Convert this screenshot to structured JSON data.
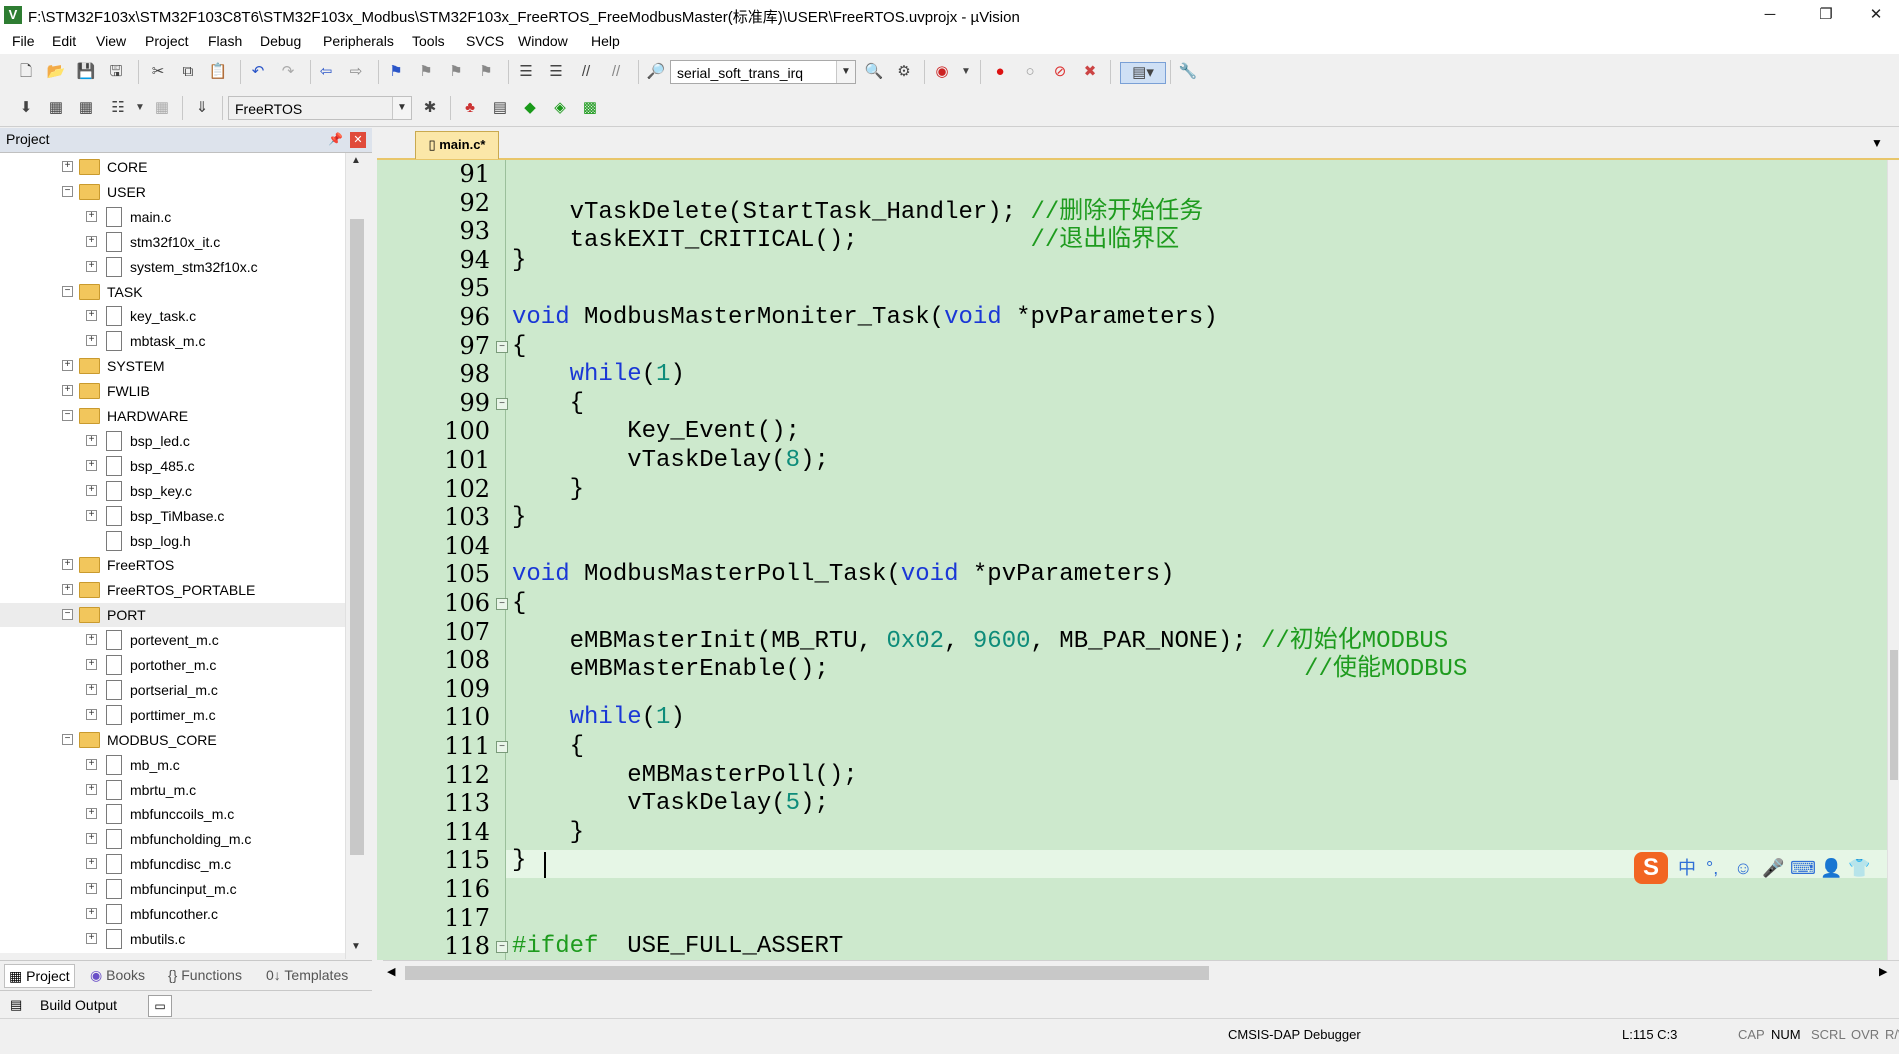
{
  "window": {
    "title": "F:\\STM32F103x\\STM32F103C8T6\\STM32F103x_Modbus\\STM32F103x_FreeRTOS_FreeModbusMaster(标准库)\\USER\\FreeRTOS.uvprojx - µVision",
    "minimize_glyph": "─",
    "restore_glyph": "❐",
    "close_glyph": "✕",
    "app_icon_letter": "V"
  },
  "menu": [
    "File",
    "Edit",
    "View",
    "Project",
    "Flash",
    "Debug",
    "Peripherals",
    "Tools",
    "SVCS",
    "Window",
    "Help"
  ],
  "toolbar": {
    "find_combo_value": "serial_soft_trans_irq",
    "target_combo_value": "FreeRTOS"
  },
  "project_panel": {
    "title": "Project",
    "tree": [
      {
        "label": "CORE",
        "type": "folder",
        "level": 0,
        "expander": "+"
      },
      {
        "label": "USER",
        "type": "folder",
        "level": 0,
        "expander": "−"
      },
      {
        "label": "main.c",
        "type": "file",
        "level": 1,
        "expander": "+"
      },
      {
        "label": "stm32f10x_it.c",
        "type": "file",
        "level": 1,
        "expander": "+"
      },
      {
        "label": "system_stm32f10x.c",
        "type": "file",
        "level": 1,
        "expander": "+"
      },
      {
        "label": "TASK",
        "type": "folder",
        "level": 0,
        "expander": "−"
      },
      {
        "label": "key_task.c",
        "type": "file",
        "level": 1,
        "expander": "+"
      },
      {
        "label": "mbtask_m.c",
        "type": "file",
        "level": 1,
        "expander": "+"
      },
      {
        "label": "SYSTEM",
        "type": "folder",
        "level": 0,
        "expander": "+"
      },
      {
        "label": "FWLIB",
        "type": "folder",
        "level": 0,
        "expander": "+"
      },
      {
        "label": "HARDWARE",
        "type": "folder",
        "level": 0,
        "expander": "−"
      },
      {
        "label": "bsp_led.c",
        "type": "file",
        "level": 1,
        "expander": "+"
      },
      {
        "label": "bsp_485.c",
        "type": "file",
        "level": 1,
        "expander": "+"
      },
      {
        "label": "bsp_key.c",
        "type": "file",
        "level": 1,
        "expander": "+"
      },
      {
        "label": "bsp_TiMbase.c",
        "type": "file",
        "level": 1,
        "expander": "+"
      },
      {
        "label": "bsp_log.h",
        "type": "file",
        "level": 1,
        "expander": ""
      },
      {
        "label": "FreeRTOS",
        "type": "folder",
        "level": 0,
        "expander": "+"
      },
      {
        "label": "FreeRTOS_PORTABLE",
        "type": "folder",
        "level": 0,
        "expander": "+"
      },
      {
        "label": "PORT",
        "type": "folder",
        "level": 0,
        "expander": "−"
      },
      {
        "label": "portevent_m.c",
        "type": "file",
        "level": 1,
        "expander": "+"
      },
      {
        "label": "portother_m.c",
        "type": "file",
        "level": 1,
        "expander": "+"
      },
      {
        "label": "portserial_m.c",
        "type": "file",
        "level": 1,
        "expander": "+"
      },
      {
        "label": "porttimer_m.c",
        "type": "file",
        "level": 1,
        "expander": "+"
      },
      {
        "label": "MODBUS_CORE",
        "type": "folder",
        "level": 0,
        "expander": "−"
      },
      {
        "label": "mb_m.c",
        "type": "file",
        "level": 1,
        "expander": "+"
      },
      {
        "label": "mbrtu_m.c",
        "type": "file",
        "level": 1,
        "expander": "+"
      },
      {
        "label": "mbfunccoils_m.c",
        "type": "file",
        "level": 1,
        "expander": "+"
      },
      {
        "label": "mbfuncholding_m.c",
        "type": "file",
        "level": 1,
        "expander": "+"
      },
      {
        "label": "mbfuncdisc_m.c",
        "type": "file",
        "level": 1,
        "expander": "+"
      },
      {
        "label": "mbfuncinput_m.c",
        "type": "file",
        "level": 1,
        "expander": "+"
      },
      {
        "label": "mbfuncother.c",
        "type": "file",
        "level": 1,
        "expander": "+"
      },
      {
        "label": "mbutils.c",
        "type": "file",
        "level": 1,
        "expander": "+"
      }
    ],
    "tabs": [
      "Project",
      "Books",
      "{} Functions",
      "0↓ Templates"
    ],
    "build_output_label": "Build Output"
  },
  "editor": {
    "tab_label": "main.c*",
    "lines": [
      {
        "n": "91",
        "fold": "",
        "parts": []
      },
      {
        "n": "92",
        "fold": "",
        "parts": [
          [
            "",
            "    vTaskDelete(StartTask_Handler); "
          ],
          [
            "cmt",
            "//删除开始任务"
          ]
        ]
      },
      {
        "n": "93",
        "fold": "",
        "parts": [
          [
            "",
            "    taskEXIT_CRITICAL();            "
          ],
          [
            "cmt",
            "//退出临界区"
          ]
        ]
      },
      {
        "n": "94",
        "fold": "",
        "parts": [
          [
            "",
            "}"
          ]
        ]
      },
      {
        "n": "95",
        "fold": "",
        "parts": []
      },
      {
        "n": "96",
        "fold": "",
        "parts": [
          [
            "kw",
            "void"
          ],
          [
            "",
            " ModbusMasterMoniter_Task("
          ],
          [
            "kw",
            "void"
          ],
          [
            "",
            " *pvParameters)"
          ]
        ]
      },
      {
        "n": "97",
        "fold": "−",
        "parts": [
          [
            "",
            "{"
          ]
        ]
      },
      {
        "n": "98",
        "fold": "",
        "parts": [
          [
            "",
            "    "
          ],
          [
            "kw",
            "while"
          ],
          [
            "",
            "("
          ],
          [
            "num",
            "1"
          ],
          [
            "",
            ")"
          ]
        ]
      },
      {
        "n": "99",
        "fold": "−",
        "parts": [
          [
            "",
            "    {"
          ]
        ]
      },
      {
        "n": "100",
        "fold": "",
        "parts": [
          [
            "",
            "        Key_Event();"
          ]
        ]
      },
      {
        "n": "101",
        "fold": "",
        "parts": [
          [
            "",
            "        vTaskDelay("
          ],
          [
            "num",
            "8"
          ],
          [
            "",
            ");"
          ]
        ]
      },
      {
        "n": "102",
        "fold": "",
        "parts": [
          [
            "",
            "    }"
          ]
        ]
      },
      {
        "n": "103",
        "fold": "",
        "parts": [
          [
            "",
            "}"
          ]
        ]
      },
      {
        "n": "104",
        "fold": "",
        "parts": []
      },
      {
        "n": "105",
        "fold": "",
        "parts": [
          [
            "kw",
            "void"
          ],
          [
            "",
            " ModbusMasterPoll_Task("
          ],
          [
            "kw",
            "void"
          ],
          [
            "",
            " *pvParameters)"
          ]
        ]
      },
      {
        "n": "106",
        "fold": "−",
        "parts": [
          [
            "",
            "{"
          ]
        ]
      },
      {
        "n": "107",
        "fold": "",
        "parts": [
          [
            "",
            "    eMBMasterInit(MB_RTU, "
          ],
          [
            "num",
            "0x02"
          ],
          [
            "",
            ", "
          ],
          [
            "num",
            "9600"
          ],
          [
            "",
            ", MB_PAR_NONE); "
          ],
          [
            "cmt",
            "//初始化MODBUS"
          ]
        ]
      },
      {
        "n": "108",
        "fold": "",
        "parts": [
          [
            "",
            "    eMBMasterEnable();                                 "
          ],
          [
            "cmt",
            "//使能MODBUS"
          ]
        ]
      },
      {
        "n": "109",
        "fold": "",
        "parts": []
      },
      {
        "n": "110",
        "fold": "",
        "parts": [
          [
            "",
            "    "
          ],
          [
            "kw",
            "while"
          ],
          [
            "",
            "("
          ],
          [
            "num",
            "1"
          ],
          [
            "",
            ")"
          ]
        ]
      },
      {
        "n": "111",
        "fold": "−",
        "parts": [
          [
            "",
            "    {"
          ]
        ]
      },
      {
        "n": "112",
        "fold": "",
        "parts": [
          [
            "",
            "        eMBMasterPoll();"
          ]
        ]
      },
      {
        "n": "113",
        "fold": "",
        "parts": [
          [
            "",
            "        vTaskDelay("
          ],
          [
            "num",
            "5"
          ],
          [
            "",
            ");"
          ]
        ]
      },
      {
        "n": "114",
        "fold": "",
        "parts": [
          [
            "",
            "    }"
          ]
        ]
      },
      {
        "n": "115",
        "fold": "",
        "parts": [
          [
            "",
            "}"
          ]
        ]
      },
      {
        "n": "116",
        "fold": "",
        "parts": []
      },
      {
        "n": "117",
        "fold": "",
        "parts": []
      },
      {
        "n": "118",
        "fold": "−",
        "parts": [
          [
            "cmt",
            "#ifdef"
          ],
          [
            "",
            "  USE_FULL_ASSERT"
          ]
        ]
      }
    ]
  },
  "ime": {
    "logo": "S",
    "items": [
      "中",
      "°,",
      "☺",
      "🎤",
      "⌨",
      "👤",
      "👕"
    ]
  },
  "status": {
    "debugger": "CMSIS-DAP Debugger",
    "position": "L:115 C:3",
    "cap": "CAP",
    "num": "NUM",
    "scrl": "SCRL",
    "ovr": "OVR",
    "rw": "R/W"
  },
  "colors": {
    "editor_bg": "#cde9cd",
    "keyword": "#1a37d6",
    "number": "#0e8c7a",
    "comment": "#1e9b1e"
  }
}
